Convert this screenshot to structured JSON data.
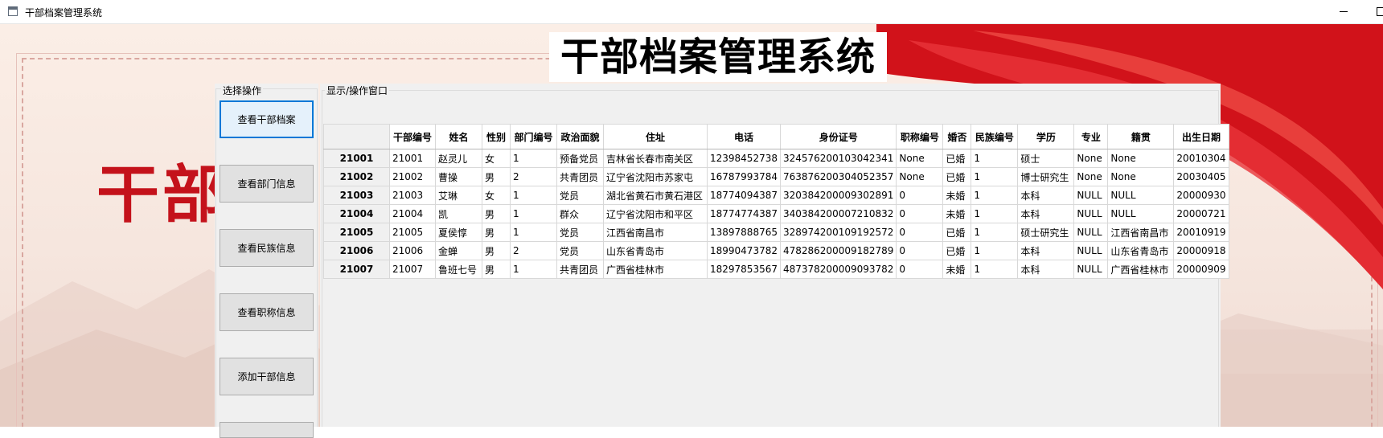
{
  "window": {
    "title": "干部档案管理系统",
    "minimize_glyph": "—",
    "maximize_glyph": "☐"
  },
  "header": {
    "big_title": "干部档案管理系统",
    "background_text": "干部"
  },
  "operations": {
    "caption": "选择操作",
    "buttons": [
      "查看干部档案",
      "查看部门信息",
      "查看民族信息",
      "查看职称信息",
      "添加干部信息"
    ]
  },
  "display": {
    "caption": "显示/操作窗口"
  },
  "table": {
    "columns": [
      "干部编号",
      "姓名",
      "性别",
      "部门编号",
      "政治面貌",
      "住址",
      "电话",
      "身份证号",
      "职称编号",
      "婚否",
      "民族编号",
      "学历",
      "专业",
      "籍贯",
      "出生日期"
    ],
    "row_headers": [
      "21001",
      "21002",
      "21003",
      "21004",
      "21005",
      "21006",
      "21007"
    ],
    "rows": [
      [
        "21001",
        "赵灵儿",
        "女",
        "1",
        "预备党员",
        "吉林省长春市南关区",
        "12398452738",
        "324576200103042341",
        "None",
        "已婚",
        "1",
        "硕士",
        "None",
        "None",
        "20010304"
      ],
      [
        "21002",
        "曹操",
        "男",
        "2",
        "共青团员",
        "辽宁省沈阳市苏家屯",
        "16787993784",
        "763876200304052357",
        "None",
        "已婚",
        "1",
        "博士研究生",
        "None",
        "None",
        "20030405"
      ],
      [
        "21003",
        "艾琳",
        "女",
        "1",
        "党员",
        "湖北省黄石市黄石港区",
        "18774094387",
        "320384200009302891",
        "0",
        "未婚",
        "1",
        "本科",
        "NULL",
        "NULL",
        "20000930"
      ],
      [
        "21004",
        "凯",
        "男",
        "1",
        "群众",
        "辽宁省沈阳市和平区",
        "18774774387",
        "340384200007210832",
        "0",
        "未婚",
        "1",
        "本科",
        "NULL",
        "NULL",
        "20000721"
      ],
      [
        "21005",
        "夏侯惇",
        "男",
        "1",
        "党员",
        "江西省南昌市",
        "13897888765",
        "328974200109192572",
        "0",
        "已婚",
        "1",
        "硕士研究生",
        "NULL",
        "江西省南昌市",
        "20010919"
      ],
      [
        "21006",
        "金蝉",
        "男",
        "2",
        "党员",
        "山东省青岛市",
        "18990473782",
        "478286200009182789",
        "0",
        "已婚",
        "1",
        "本科",
        "NULL",
        "山东省青岛市",
        "20000918"
      ],
      [
        "21007",
        "鲁班七号",
        "男",
        "1",
        "共青团员",
        "广西省桂林市",
        "18297853567",
        "487378200009093782",
        "0",
        "未婚",
        "1",
        "本科",
        "NULL",
        "广西省桂林市",
        "20000909"
      ]
    ]
  },
  "colors": {
    "accent_red": "#c4121b",
    "focus_blue": "#0078d7",
    "panel_gray": "#f0f0f0"
  }
}
